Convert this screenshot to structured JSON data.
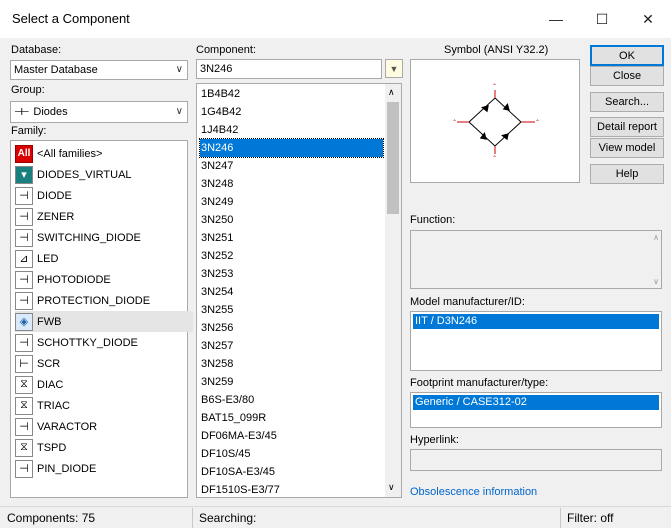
{
  "window": {
    "title": "Select a Component",
    "min_label": "—",
    "max_label": "☐",
    "close_label": "✕"
  },
  "database": {
    "label": "Database:",
    "value": "Master Database"
  },
  "group": {
    "label": "Group:",
    "value": "Diodes",
    "icon_glyph": "⊣⊢"
  },
  "family": {
    "label": "Family:",
    "items": [
      {
        "label": "<All families>",
        "icon": "all-families-icon",
        "glyph": "All"
      },
      {
        "label": "DIODES_VIRTUAL",
        "icon": "diode-virtual-icon",
        "glyph": "▾"
      },
      {
        "label": "DIODE",
        "icon": "diode-icon",
        "glyph": "⊣"
      },
      {
        "label": "ZENER",
        "icon": "zener-icon",
        "glyph": "⊣"
      },
      {
        "label": "SWITCHING_DIODE",
        "icon": "switching-diode-icon",
        "glyph": "⊣"
      },
      {
        "label": "LED",
        "icon": "led-icon",
        "glyph": "⊿"
      },
      {
        "label": "PHOTODIODE",
        "icon": "photodiode-icon",
        "glyph": "⊣"
      },
      {
        "label": "PROTECTION_DIODE",
        "icon": "protection-diode-icon",
        "glyph": "⊣"
      },
      {
        "label": "FWB",
        "icon": "fwb-icon",
        "glyph": "◈"
      },
      {
        "label": "SCHOTTKY_DIODE",
        "icon": "schottky-icon",
        "glyph": "⊣"
      },
      {
        "label": "SCR",
        "icon": "scr-icon",
        "glyph": "⊢"
      },
      {
        "label": "DIAC",
        "icon": "diac-icon",
        "glyph": "⧖"
      },
      {
        "label": "TRIAC",
        "icon": "triac-icon",
        "glyph": "⧖"
      },
      {
        "label": "VARACTOR",
        "icon": "varactor-icon",
        "glyph": "⊣"
      },
      {
        "label": "TSPD",
        "icon": "tspd-icon",
        "glyph": "⧖"
      },
      {
        "label": "PIN_DIODE",
        "icon": "pin-diode-icon",
        "glyph": "⊣"
      }
    ]
  },
  "component": {
    "label": "Component:",
    "search_value": "3N246",
    "filter_icon_glyph": "▼",
    "items": [
      "1B4B42",
      "1G4B42",
      "1J4B42",
      "3N246",
      "3N247",
      "3N248",
      "3N249",
      "3N250",
      "3N251",
      "3N252",
      "3N253",
      "3N254",
      "3N255",
      "3N256",
      "3N257",
      "3N258",
      "3N259",
      "B6S-E3/80",
      "BAT15_099R",
      "DF06MA-E3/45",
      "DF10S/45",
      "DF10SA-E3/45",
      "DF1510S-E3/77"
    ]
  },
  "symbol": {
    "label": "Symbol (ANSI Y32.2)"
  },
  "buttons": {
    "ok": "OK",
    "close": "Close",
    "search": "Search...",
    "detail_report": "Detail report",
    "view_model": "View model",
    "help": "Help"
  },
  "function": {
    "label": "Function:"
  },
  "model": {
    "label": "Model manufacturer/ID:",
    "value": "IIT / D3N246"
  },
  "footprint": {
    "label": "Footprint manufacturer/type:",
    "value": "Generic / CASE312-02"
  },
  "hyperlink": {
    "label": "Hyperlink:"
  },
  "obsolescence": {
    "label": "Obsolescence information"
  },
  "status": {
    "components": "Components: 75",
    "searching": "Searching:",
    "filter": "Filter: off"
  },
  "colors": {
    "selection": "#0078d7",
    "link": "#0066cc",
    "all_families_red": "#d90000"
  }
}
